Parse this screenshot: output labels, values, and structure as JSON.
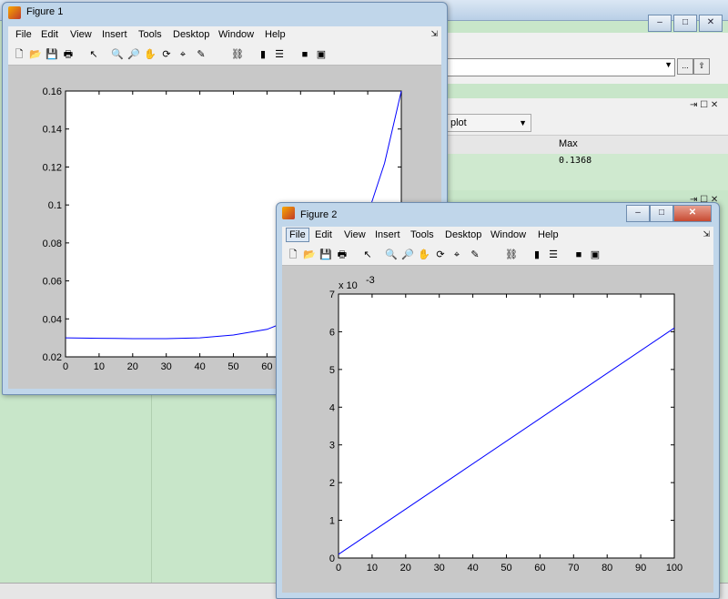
{
  "background": {
    "tabs": [
      "..."
    ],
    "dropdown_value": "plot",
    "header": "Max",
    "row_value": "0.1368"
  },
  "figure1": {
    "title": "Figure 1",
    "menu": [
      "File",
      "Edit",
      "View",
      "Insert",
      "Tools",
      "Desktop",
      "Window",
      "Help"
    ]
  },
  "figure2": {
    "title": "Figure 2",
    "menu": [
      "File",
      "Edit",
      "View",
      "Insert",
      "Tools",
      "Desktop",
      "Window",
      "Help"
    ]
  },
  "toolbar_icons": [
    "new-icon",
    "open-icon",
    "save-icon",
    "print-icon",
    "pointer-icon",
    "zoom-in-icon",
    "zoom-out-icon",
    "pan-icon",
    "rotate-icon",
    "data-cursor-icon",
    "brush-icon",
    "link-icon",
    "colorbar-icon",
    "legend-icon",
    "hide-tools-icon",
    "show-tools-icon"
  ],
  "colors": {
    "line": "#0000ff",
    "canvas": "#c8c8c8",
    "axes_bg": "#ffffff"
  },
  "chart_data": [
    {
      "type": "line",
      "xlim": [
        0,
        100
      ],
      "ylim": [
        0.02,
        0.16
      ],
      "xticks": [
        0,
        10,
        20,
        30,
        40,
        50,
        60,
        70,
        80,
        90,
        100
      ],
      "yticks": [
        0.02,
        0.04,
        0.06,
        0.08,
        0.1,
        0.12,
        0.14,
        0.16
      ],
      "xtick_labels": [
        "0",
        "10",
        "20",
        "30",
        "40",
        "50",
        "60"
      ],
      "ytick_labels": [
        "0.02",
        "0.04",
        "0.06",
        "0.08",
        "0.1",
        "0.12",
        "0.14",
        "0.16"
      ],
      "series": [
        {
          "x": [
            0,
            10,
            20,
            30,
            40,
            50,
            60,
            65,
            70,
            80,
            85,
            90,
            95,
            100
          ],
          "y": [
            0.03,
            0.0298,
            0.0296,
            0.0296,
            0.03,
            0.0315,
            0.0345,
            0.038,
            0.043,
            0.06,
            0.075,
            0.095,
            0.122,
            0.16
          ]
        }
      ]
    },
    {
      "type": "line",
      "xlim": [
        0,
        100
      ],
      "ylim": [
        0,
        7
      ],
      "exponent_label": "x 10",
      "exponent_power": "-3",
      "xticks": [
        0,
        10,
        20,
        30,
        40,
        50,
        60,
        70,
        80,
        90,
        100
      ],
      "yticks": [
        0,
        1,
        2,
        3,
        4,
        5,
        6,
        7
      ],
      "xtick_labels": [
        "0",
        "10",
        "20",
        "30",
        "40",
        "50",
        "60",
        "70",
        "80",
        "90",
        "100"
      ],
      "ytick_labels": [
        "0",
        "1",
        "2",
        "3",
        "4",
        "5",
        "6",
        "7"
      ],
      "series": [
        {
          "x": [
            0,
            100
          ],
          "y": [
            0.1,
            6.1
          ]
        }
      ]
    }
  ]
}
